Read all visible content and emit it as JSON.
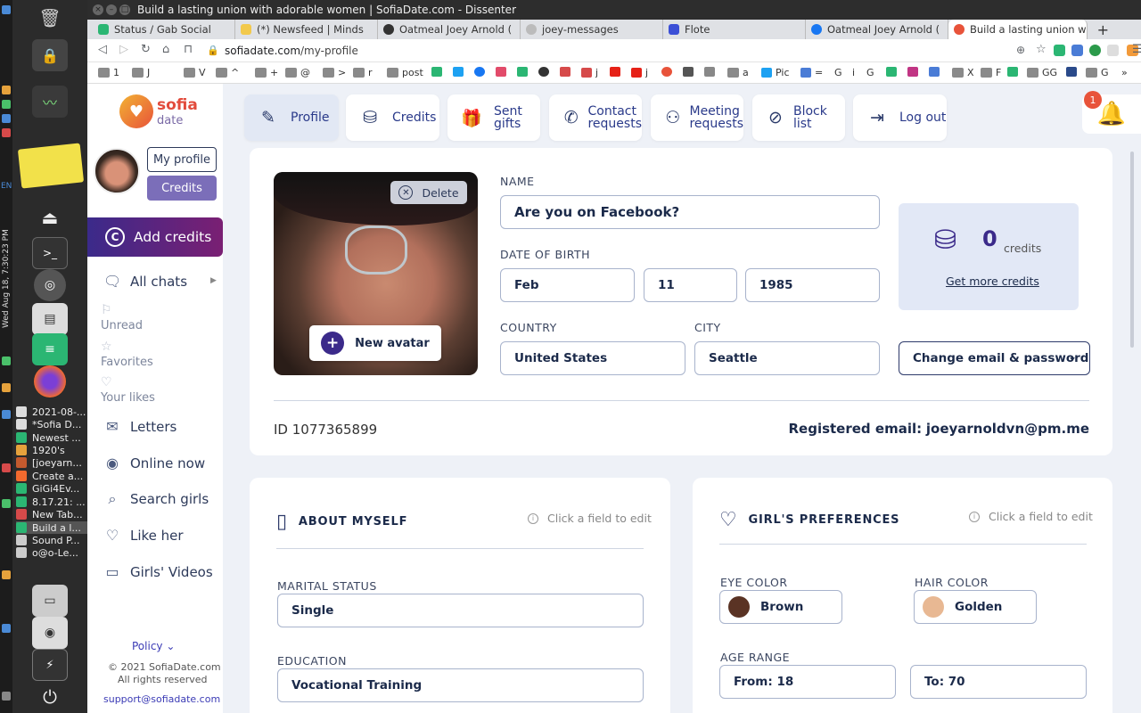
{
  "dock": {
    "clock": "Wed Aug 18,  7:30:23 PM",
    "lang": "EN"
  },
  "launcher": {
    "windows": [
      "2021-08-...",
      "*Sofia D...",
      "Newest ...",
      "1920's",
      "[joeyarn...",
      "Create a...",
      "GiGi4Ev...",
      "8.17.21: ...",
      "New Tab...",
      "Build a l...",
      "Sound P...",
      "o@o-Le..."
    ]
  },
  "browser": {
    "title": "Build a lasting union with adorable women | SofiaDate.com - Dissenter",
    "tabs": [
      "Status / Gab Social",
      "(*) Newsfeed | Minds",
      "Oatmeal Joey Arnold (",
      "joey-messages",
      "Flote",
      "Oatmeal Joey Arnold (",
      "Build a lasting union w"
    ],
    "url_host": "sofiadate.com",
    "url_path": "/my-profile",
    "bookmarks": [
      "1",
      "J",
      "V",
      "^",
      "+",
      "@",
      ">",
      "r",
      "post",
      "j",
      "j",
      "a",
      "Pic",
      "=",
      "G",
      "i",
      "G",
      "X",
      "F",
      "GG",
      "G"
    ],
    "colors": {
      "accent": "#3b2a8a",
      "danger": "#e8533a"
    }
  },
  "sidebar": {
    "logo_line1": "sofia",
    "logo_line2": "date",
    "my_profile": "My profile",
    "credits": "Credits",
    "add_credits": "Add credits",
    "all_chats": "All chats",
    "unread": "Unread",
    "favorites": "Favorites",
    "your_likes": "Your likes",
    "letters": "Letters",
    "online_now": "Online now",
    "search_girls": "Search girls",
    "like_her": "Like her",
    "girls_videos": "Girls' Videos",
    "policy": "Policy",
    "copyright": "© 2021 SofiaDate.com",
    "rights": "All rights reserved",
    "support": "support@sofiadate.com"
  },
  "topnav": {
    "profile": "Profile",
    "credits": "Credits",
    "sent_gifts_1": "Sent",
    "sent_gifts_2": "gifts",
    "contact_1": "Contact",
    "contact_2": "requests",
    "meeting_1": "Meeting",
    "meeting_2": "requests",
    "block_list": "Block list",
    "log_out": "Log out",
    "notif_count": "1"
  },
  "profile": {
    "delete": "Delete",
    "new_avatar": "New avatar",
    "name_label": "NAME",
    "name": "Are you on Facebook?",
    "dob_label": "DATE OF BIRTH",
    "dob_month": "Feb",
    "dob_day": "11",
    "dob_year": "1985",
    "country_label": "COUNTRY",
    "country": "United States",
    "city_label": "CITY",
    "city": "Seattle",
    "credits_count": "0",
    "credits_word": "credits",
    "get_more": "Get more credits",
    "change_email": "Change email & password",
    "id_text": "ID 1077365899",
    "reg_email_label": "Registered email:",
    "reg_email": "joeyarnoldvn@pm.me"
  },
  "about": {
    "title": "ABOUT MYSELF",
    "hint": "Click a field to edit",
    "marital_label": "MARITAL STATUS",
    "marital": "Single",
    "education_label": "EDUCATION",
    "education": "Vocational Training"
  },
  "prefs": {
    "title": "GIRL'S PREFERENCES",
    "hint": "Click a field to edit",
    "eye_label": "EYE COLOR",
    "eye": "Brown",
    "eye_color": "#5a3324",
    "hair_label": "HAIR COLOR",
    "hair": "Golden",
    "hair_color": "#e8b893",
    "age_label": "AGE RANGE",
    "age_from": "From: 18",
    "age_to": "To: 70"
  }
}
